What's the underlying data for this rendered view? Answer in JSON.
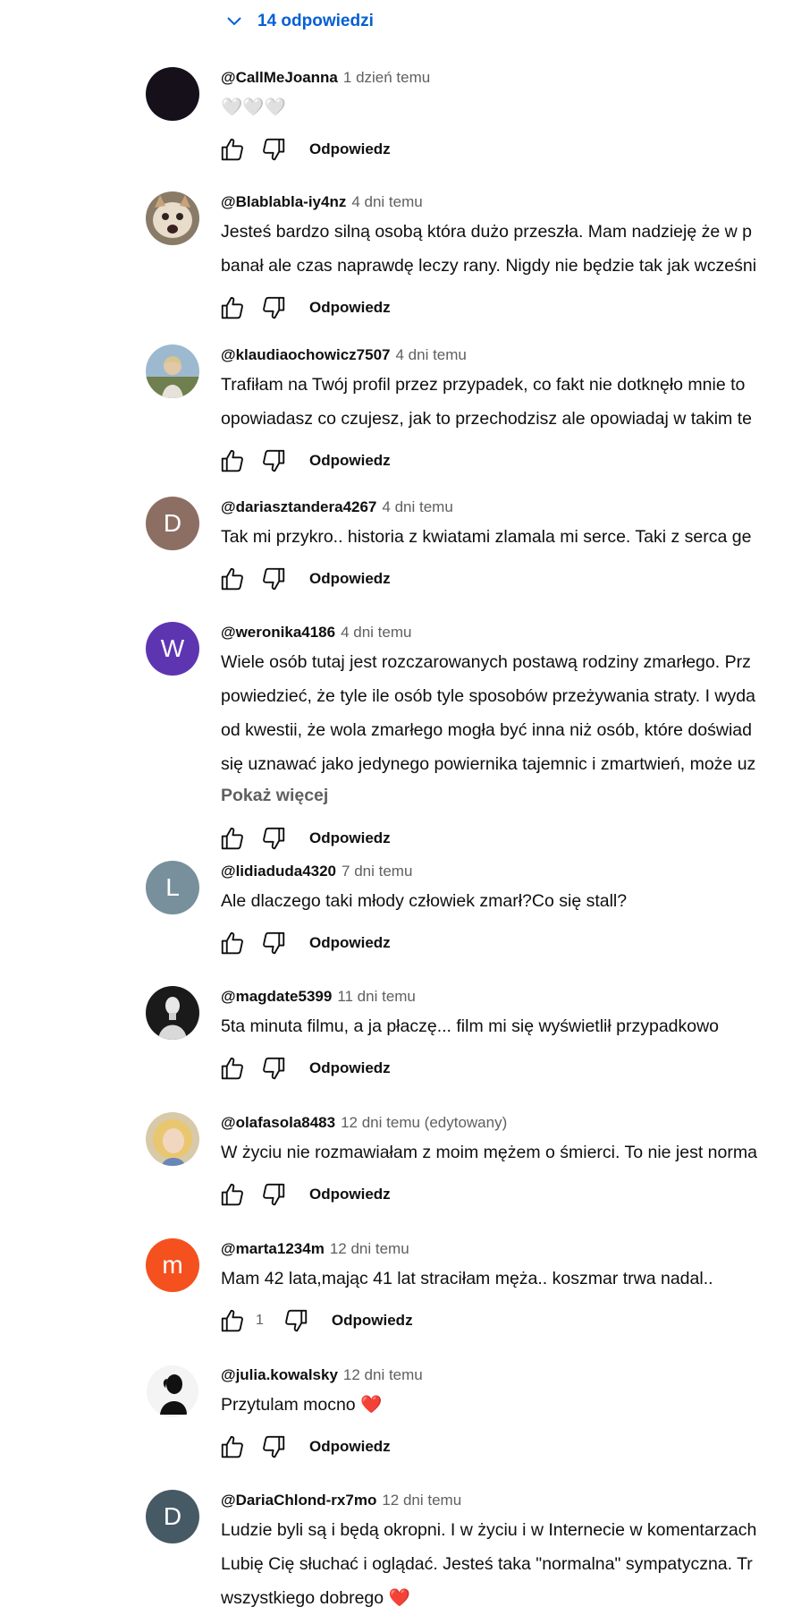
{
  "replies_toggle": {
    "label": "14 odpowiedzi"
  },
  "reply_label": "Odpowiedz",
  "comments": [
    {
      "author": "@CallMeJoanna",
      "time": "1 dzień temu",
      "lines": [
        "🤍🤍🤍"
      ],
      "avatar": {
        "type": "dark",
        "color": "#16101a"
      }
    },
    {
      "author": "@Blablabla-iy4nz",
      "time": "4 dni temu",
      "lines": [
        "Jesteś bardzo silną osobą która dużo przeszła. Mam nadzieję że w p",
        "banał ale czas naprawdę leczy rany. Nigdy nie będzie tak jak wcześni"
      ],
      "avatar": {
        "type": "cat"
      }
    },
    {
      "author": "@klaudiaochowicz7507",
      "time": "4 dni temu",
      "lines": [
        "Trafiłam na Twój profil przez przypadek, co fakt nie dotknęło mnie to",
        "opowiadasz co czujesz, jak to przechodzisz ale opowiadaj w takim te"
      ],
      "avatar": {
        "type": "photo-outdoor"
      }
    },
    {
      "author": "@dariasztandera4267",
      "time": "4 dni temu",
      "lines": [
        "Tak mi przykro.. historia z kwiatami zlamala mi serce. Taki z serca ge"
      ],
      "avatar": {
        "type": "letter",
        "letter": "D",
        "color": "#8d6e63"
      }
    },
    {
      "author": "@weronika4186",
      "time": "4 dni temu",
      "lines": [
        "Wiele osób tutaj jest rozczarowanych postawą rodziny zmarłego. Prz",
        "powiedzieć, że tyle ile osób tyle sposobów przeżywania straty. I wyda",
        "od kwestii, że wola zmarłego mogła być inna niż osób, które doświad",
        "się uznawać jako jedynego powiernika tajemnic i zmartwień, może uz"
      ],
      "more": "Pokaż więcej",
      "avatar": {
        "type": "letter",
        "letter": "W",
        "color": "#5e35b1"
      }
    },
    {
      "author": "@lidiaduda4320",
      "time": "7 dni temu",
      "lines": [
        "Ale dlaczego taki młody człowiek zmarł?Co się stall?"
      ],
      "avatar": {
        "type": "letter",
        "letter": "L",
        "color": "#78909c"
      }
    },
    {
      "author": "@magdate5399",
      "time": "11 dni temu",
      "lines": [
        "5ta minuta filmu, a ja płaczę... film mi się wyświetlił przypadkowo"
      ],
      "avatar": {
        "type": "photo-bust"
      }
    },
    {
      "author": "@olafasola8483",
      "time": "12 dni temu (edytowany)",
      "lines": [
        "W życiu nie rozmawiałam z moim mężem o śmierci. To nie jest norma"
      ],
      "avatar": {
        "type": "photo-blonde"
      }
    },
    {
      "author": "@marta1234m",
      "time": "12 dni temu",
      "lines": [
        "Mam 42 lata,mając 41 lat straciłam męża.. koszmar trwa nadal.."
      ],
      "likes": "1",
      "avatar": {
        "type": "letter",
        "letter": "m",
        "color": "#f4511e"
      }
    },
    {
      "author": "@julia.kowalsky",
      "time": "12 dni temu",
      "lines": [
        "Przytulam mocno ❤️"
      ],
      "avatar": {
        "type": "silhouette"
      }
    },
    {
      "author": "@DariaChlond-rx7mo",
      "time": "12 dni temu",
      "lines": [
        "Ludzie byli są i będą okropni. I w życiu i w Internecie w komentarzach",
        " Lubię Cię słuchać i oglądać. Jesteś taka \"normalna\" sympatyczna. Tr",
        "wszystkiego dobrego  ❤️"
      ],
      "avatar": {
        "type": "letter",
        "letter": "D",
        "color": "#455a64"
      }
    }
  ]
}
